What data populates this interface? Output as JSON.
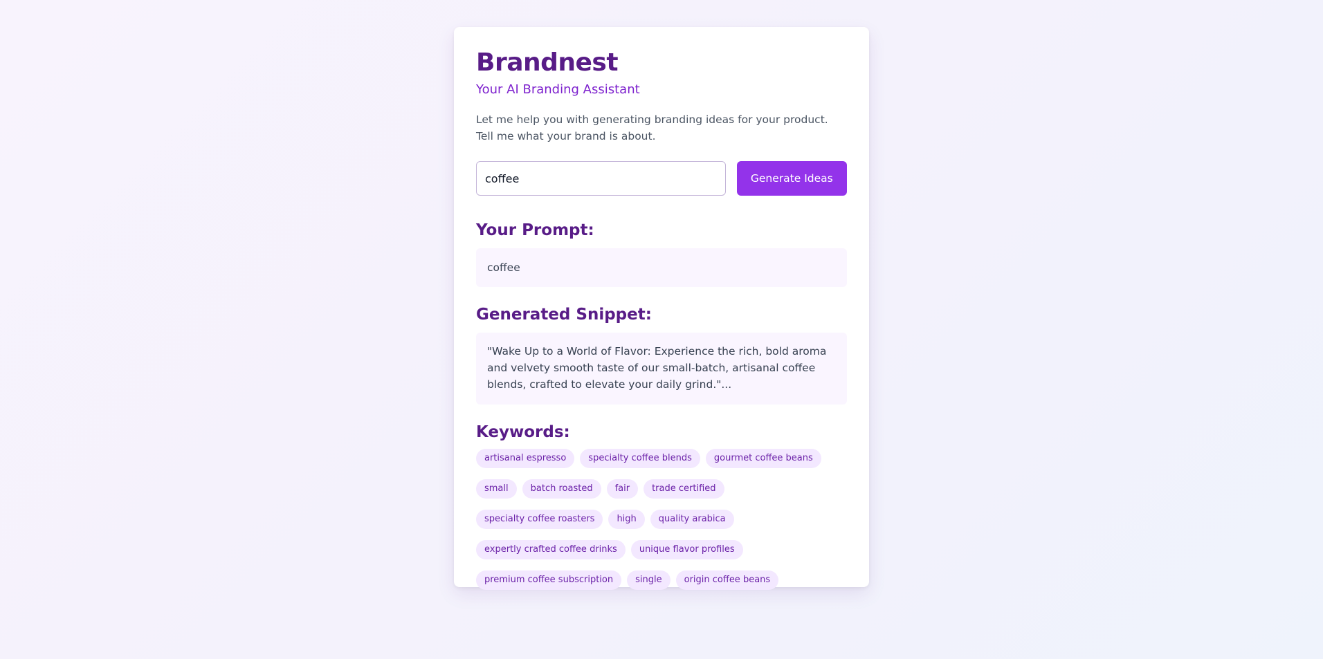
{
  "app": {
    "title": "Brandnest",
    "subtitle": "Your AI Branding Assistant",
    "intro_line1": "Let me help you with generating branding ideas for your product.",
    "intro_line2": "Tell me what your brand is about."
  },
  "form": {
    "input_value": "coffee",
    "button_label": "Generate Ideas"
  },
  "prompt_section": {
    "title": "Your Prompt:",
    "text": "coffee"
  },
  "snippet_section": {
    "title": "Generated Snippet:",
    "text": "\"Wake Up to a World of Flavor: Experience the rich, bold aroma and velvety smooth taste of our small-batch, artisanal coffee blends, crafted to elevate your daily grind.\"..."
  },
  "keywords_section": {
    "title": "Keywords:",
    "rows": [
      [
        "artisanal espresso",
        "specialty coffee blends",
        "gourmet coffee beans"
      ],
      [
        "small",
        "batch roasted",
        "fair",
        "trade certified"
      ],
      [
        "specialty coffee roasters",
        "high",
        "quality arabica"
      ],
      [
        "expertly crafted coffee drinks",
        "unique flavor profiles"
      ],
      [
        "premium coffee subscription",
        "single",
        "origin coffee beans"
      ]
    ]
  },
  "colors": {
    "brand": "#581c87",
    "accent": "#9333ea",
    "chip_bg": "#f3e8ff",
    "box_bg": "#faf5ff"
  }
}
